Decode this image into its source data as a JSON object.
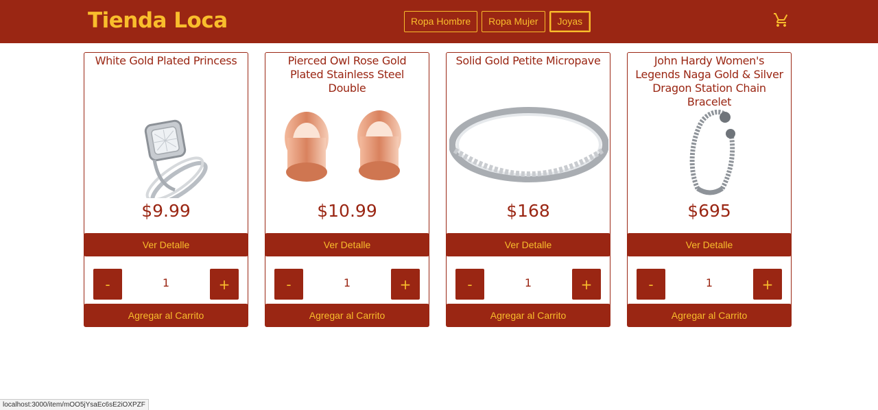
{
  "header": {
    "brand": "Tienda Loca",
    "nav": [
      {
        "label": "Ropa Hombre"
      },
      {
        "label": "Ropa Mujer"
      },
      {
        "label": "Joyas"
      }
    ],
    "cart_icon": "shopping-cart-icon"
  },
  "products": [
    {
      "title": "White Gold Plated Princess",
      "price": "$9.99",
      "detail_label": "Ver Detalle",
      "minus_label": "-",
      "quantity": "1",
      "plus_label": "+",
      "add_label": "Agregar al Carrito",
      "image": "ring-image"
    },
    {
      "title": "Pierced Owl Rose Gold Plated Stainless Steel Double",
      "price": "$10.99",
      "detail_label": "Ver Detalle",
      "minus_label": "-",
      "quantity": "1",
      "plus_label": "+",
      "add_label": "Agregar al Carrito",
      "image": "plugs-image"
    },
    {
      "title": "Solid Gold Petite Micropave",
      "price": "$168",
      "detail_label": "Ver Detalle",
      "minus_label": "-",
      "quantity": "1",
      "plus_label": "+",
      "add_label": "Agregar al Carrito",
      "image": "band-image"
    },
    {
      "title": "John Hardy Women's Legends Naga Gold & Silver Dragon Station Chain Bracelet",
      "price": "$695",
      "detail_label": "Ver Detalle",
      "minus_label": "-",
      "quantity": "1",
      "plus_label": "+",
      "add_label": "Agregar al Carrito",
      "image": "bracelet-image"
    }
  ],
  "status_bar": {
    "url": "localhost:3000/item/mOO5jYsaEc6sE2iOXPZF"
  },
  "colors": {
    "primary": "#9a2613",
    "accent": "#f9bd2c",
    "background": "#ffffff"
  }
}
